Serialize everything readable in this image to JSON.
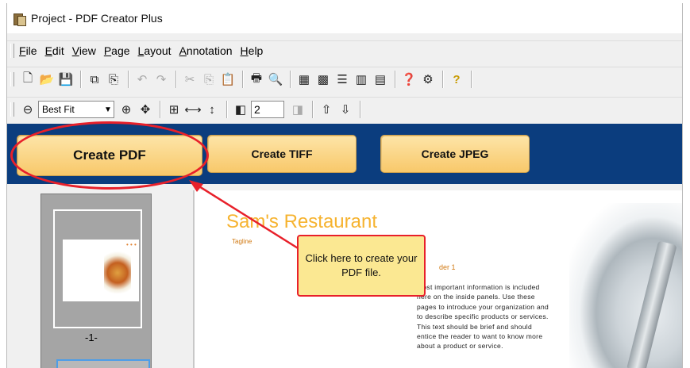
{
  "window": {
    "title": "Project - PDF Creator Plus"
  },
  "menu": [
    "File",
    "Edit",
    "View",
    "Page",
    "Layout",
    "Annotation",
    "Help"
  ],
  "toolbar1": {
    "icons": [
      "new-icon",
      "open-icon",
      "save-icon",
      "copy-page-icon",
      "paste-page-icon",
      "undo-icon",
      "redo-icon",
      "cut-icon",
      "copy-icon",
      "paste-icon",
      "print-icon",
      "print-preview-icon",
      "grid-icon",
      "thumbnails-icon",
      "list-icon",
      "layout-icon",
      "columns-icon",
      "help-context-icon",
      "settings-icon",
      "help-icon"
    ]
  },
  "toolbar2": {
    "zoom_value": "Best Fit",
    "page_number": "2"
  },
  "actions": {
    "create_pdf": "Create PDF",
    "create_tiff": "Create TIFF",
    "create_jpeg": "Create JPEG"
  },
  "thumbnail": {
    "page_label": "-1-"
  },
  "document": {
    "title": "Sam's Restaurant",
    "tagline": "Tagline",
    "subhead": "der 1",
    "body": "most important information is included here on the inside panels. Use these pages to introduce your organization and to describe specific products or services. This text should be brief and should entice the reader to want to know more about a product or service."
  },
  "callout": {
    "text": "Click here to create your PDF file."
  },
  "colors": {
    "band": "#0b3d7e",
    "button": "#f8c86a",
    "highlight": "#e8202a",
    "callout_bg": "#fbe892",
    "doc_title": "#f6b330"
  }
}
